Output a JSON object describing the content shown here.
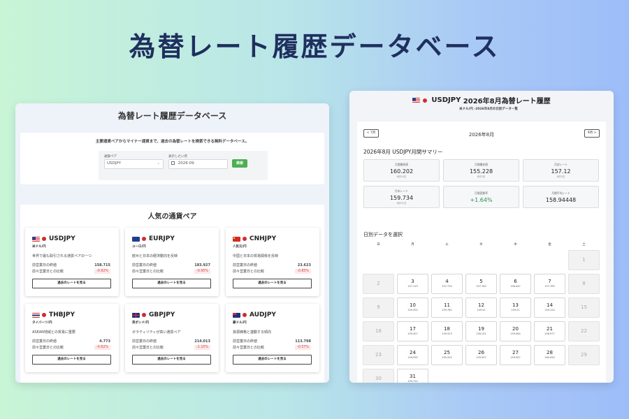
{
  "hero_title": "為替レート履歴データベース",
  "left": {
    "title": "為替レート履歴データベース",
    "search": {
      "description": "主要通貨ペアからマイナー通貨まで、過去の為替レートを検索できる無料データベース。",
      "pair_label": "通貨ペア",
      "pair_value": "USDJPY",
      "month_label": "表示したい月",
      "month_value": "2026-09",
      "search_button": "検索"
    },
    "popular_title": "人気の通貨ペア",
    "row1_label": "前営業日の終値",
    "row2_label": "前々営業日との比較",
    "button_label": "過去のレートを見る",
    "pairs": [
      {
        "code": "USDJPY",
        "flag": "us-flag-icon",
        "sub": "米ドル/円",
        "desc": "世界で最も取引される通貨ペアの一つ",
        "close": "158.715",
        "change": "-0.92%"
      },
      {
        "code": "EURJPY",
        "flag": "eu-flag-icon",
        "sub": "ユーロ/円",
        "desc": "欧州と日本の経済動向を反映",
        "close": "183.927",
        "change": "-0.95%"
      },
      {
        "code": "CNHJPY",
        "flag": "cn-flag-icon",
        "sub": "人民元/円",
        "desc": "中国と日本の貿易関係を反映",
        "close": "23.623",
        "change": "-0.85%"
      },
      {
        "code": "THBJPY",
        "flag": "th-flag-icon",
        "sub": "タイバーツ/円",
        "desc": "ASEAN地域との貿易に重要",
        "close": "4.773",
        "change": "-0.62%"
      },
      {
        "code": "GBPJPY",
        "flag": "gb-flag-icon",
        "sub": "英ポンド/円",
        "desc": "ボラティリティが高い通貨ペア",
        "close": "214.013",
        "change": "-1.15%"
      },
      {
        "code": "AUDJPY",
        "flag": "au-flag-icon",
        "sub": "豪ドル/円",
        "desc": "資源価格と連動する傾向",
        "close": "113.798",
        "change": "-0.57%"
      }
    ]
  },
  "right": {
    "pair_code": "USDJPY",
    "title_suffix": "2026年8月為替レート履歴",
    "subtitle": "米ドル/円 -2026年8月の日別データ一覧",
    "prev_button": "< 7月",
    "next_button": "9月 >",
    "month": "2026年8月",
    "summary_title": "2026年8月 USDJPY月間サマリー",
    "stats": [
      {
        "label": "月間最高値",
        "value": "160.202",
        "date": "8月24日",
        "accent": false
      },
      {
        "label": "月間最安値",
        "value": "155.228",
        "date": "8月3日",
        "accent": false
      },
      {
        "label": "月初レート",
        "value": "157.12",
        "date": "8月3日",
        "accent": false
      },
      {
        "label": "月末レート",
        "value": "159.734",
        "date": "8月31日",
        "accent": false
      },
      {
        "label": "月間変動率",
        "value": "+1.64%",
        "date": "",
        "accent": true
      },
      {
        "label": "月間平均レート",
        "value": "158.94448",
        "date": "",
        "accent": false
      }
    ],
    "calendar_title": "日別データを選択",
    "weekdays": [
      "日",
      "月",
      "火",
      "水",
      "木",
      "金",
      "土"
    ],
    "weeks": [
      [
        null,
        null,
        null,
        null,
        null,
        null,
        {
          "day": "1",
          "rate": "",
          "off": true
        }
      ],
      [
        {
          "day": "2",
          "rate": "",
          "off": true
        },
        {
          "day": "3",
          "rate": "157.119",
          "off": false
        },
        {
          "day": "4",
          "rate": "157.734",
          "off": false
        },
        {
          "day": "5",
          "rate": "157.762",
          "off": false
        },
        {
          "day": "6",
          "rate": "156.447",
          "off": false
        },
        {
          "day": "7",
          "rate": "157.783",
          "off": false
        },
        {
          "day": "8",
          "rate": "",
          "off": true
        }
      ],
      [
        {
          "day": "9",
          "rate": "",
          "off": true
        },
        {
          "day": "10",
          "rate": "159.302",
          "off": false
        },
        {
          "day": "11",
          "rate": "159.782",
          "off": false
        },
        {
          "day": "12",
          "rate": "159.41",
          "off": false
        },
        {
          "day": "13",
          "rate": "159.51",
          "off": false
        },
        {
          "day": "14",
          "rate": "159.124",
          "off": false
        },
        {
          "day": "15",
          "rate": "",
          "off": true
        }
      ],
      [
        {
          "day": "16",
          "rate": "",
          "off": true
        },
        {
          "day": "17",
          "rate": "159.407",
          "off": false
        },
        {
          "day": "18",
          "rate": "159.523",
          "off": false
        },
        {
          "day": "19",
          "rate": "158.151",
          "off": false
        },
        {
          "day": "20",
          "rate": "159.064",
          "off": false
        },
        {
          "day": "21",
          "rate": "158.977",
          "off": false
        },
        {
          "day": "22",
          "rate": "",
          "off": true
        }
      ],
      [
        {
          "day": "23",
          "rate": "",
          "off": true
        },
        {
          "day": "24",
          "rate": "159.095",
          "off": false
        },
        {
          "day": "25",
          "rate": "159.202",
          "off": false
        },
        {
          "day": "26",
          "rate": "159.507",
          "off": false
        },
        {
          "day": "27",
          "rate": "159.597",
          "off": false
        },
        {
          "day": "28",
          "rate": "160.094",
          "off": false
        },
        {
          "day": "29",
          "rate": "",
          "off": true
        }
      ],
      [
        {
          "day": "30",
          "rate": "",
          "off": true
        },
        {
          "day": "31",
          "rate": "159.724",
          "off": false
        },
        null,
        null,
        null,
        null,
        null
      ]
    ]
  }
}
